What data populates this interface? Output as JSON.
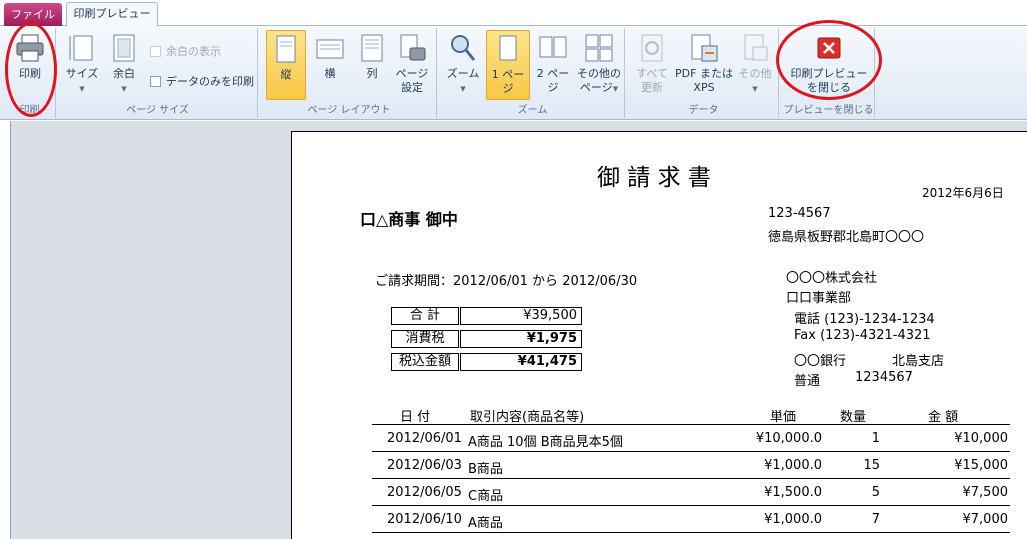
{
  "tabs": {
    "file": "ファイル",
    "preview": "印刷プレビュー"
  },
  "ribbon": {
    "print_group": {
      "print_label": "印刷",
      "group_label": "印刷"
    },
    "page_size_group": {
      "size_label": "サイズ",
      "margin_label": "余白",
      "show_margins_label": "余白の表示",
      "data_only_label": "データのみを印刷",
      "group_label": "ページ サイズ"
    },
    "page_layout_group": {
      "portrait_label": "縦",
      "landscape_label": "横",
      "columns_label": "列",
      "page_setup_label_1": "ページ",
      "page_setup_label_2": "設定",
      "group_label": "ページ レイアウト"
    },
    "zoom_group": {
      "zoom_label": "ズーム",
      "one_page_label": "1 ページ",
      "two_page_label": "2 ページ",
      "other_pages_label_1": "その他の",
      "other_pages_label_2": "ページ",
      "group_label": "ズーム"
    },
    "data_group": {
      "refresh_all_label_1": "すべて",
      "refresh_all_label_2": "更新",
      "pdf_xps_label_1": "PDF または",
      "pdf_xps_label_2": "XPS",
      "more_label": "その他",
      "group_label": "データ"
    },
    "close_group": {
      "close_label_1": "印刷プレビュー",
      "close_label_2": "を閉じる",
      "group_label": "プレビューを閉じる"
    }
  },
  "invoice": {
    "title": "御 請 求 書",
    "date": "2012年6月6日",
    "recipient": "口△商事 御中",
    "postal": "123-4567",
    "address": "徳島県板野郡北島町〇〇〇",
    "period_label": "ご請求期間：2012/06/01 から 2012/06/30",
    "company": "〇〇〇株式会社",
    "division": "口口事業部",
    "phone": "電話 (123)-1234-1234",
    "fax": "Fax (123)-4321-4321",
    "bank": "〇〇銀行",
    "branch": "北島支店",
    "account_type": "普通",
    "account_number": "1234567",
    "totals": [
      {
        "label": "合 計",
        "value": "¥39,500"
      },
      {
        "label": "消費税",
        "value": "¥1,975"
      },
      {
        "label": "税込金額",
        "value": "¥41,475"
      }
    ],
    "columns": {
      "date": "日 付",
      "desc": "取引内容(商品名等)",
      "price": "単価",
      "qty": "数量",
      "amount": "金 額"
    },
    "rows": [
      {
        "date": "2012/06/01",
        "desc": "A商品 10個 B商品見本5個",
        "price": "¥10,000.0",
        "qty": "1",
        "amount": "¥10,000"
      },
      {
        "date": "2012/06/03",
        "desc": "B商品",
        "price": "¥1,000.0",
        "qty": "15",
        "amount": "¥15,000"
      },
      {
        "date": "2012/06/05",
        "desc": "C商品",
        "price": "¥1,500.0",
        "qty": "5",
        "amount": "¥7,500"
      },
      {
        "date": "2012/06/10",
        "desc": "A商品",
        "price": "¥1,000.0",
        "qty": "7",
        "amount": "¥7,000"
      }
    ]
  }
}
